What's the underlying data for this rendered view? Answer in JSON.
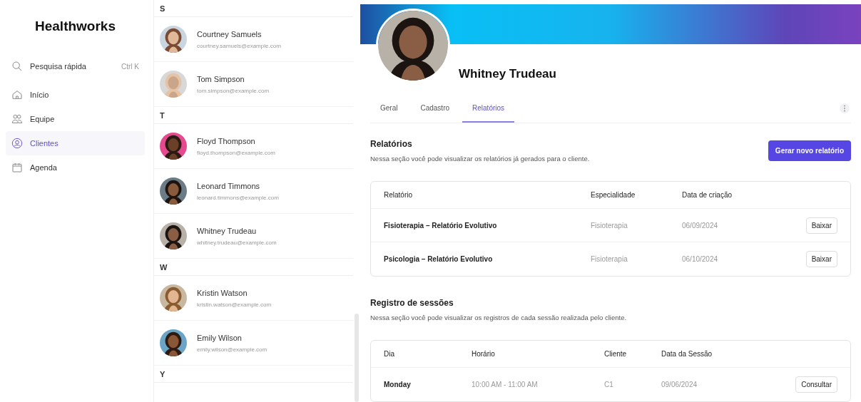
{
  "sidebar": {
    "title": "Healthworks",
    "search": {
      "label": "Pesquisa rápida",
      "shortcut": "Ctrl K"
    },
    "items": [
      {
        "label": "Início",
        "selected": false
      },
      {
        "label": "Equipe",
        "selected": false
      },
      {
        "label": "Clientes",
        "selected": true
      },
      {
        "label": "Agenda",
        "selected": false
      }
    ]
  },
  "contacts": [
    {
      "letter": "S",
      "people": [
        {
          "name": "Courtney Samuels",
          "email": "courtney.samuels@example.com"
        },
        {
          "name": "Tom Simpson",
          "email": "tom.simpson@example.com"
        }
      ]
    },
    {
      "letter": "T",
      "people": [
        {
          "name": "Floyd Thompson",
          "email": "floyd.thompson@example.com"
        },
        {
          "name": "Leonard Timmons",
          "email": "leonard.timmons@example.com"
        },
        {
          "name": "Whitney Trudeau",
          "email": "whitney.trudeau@example.com"
        }
      ]
    },
    {
      "letter": "W",
      "people": [
        {
          "name": "Kristin Watson",
          "email": "kristin.watson@example.com"
        },
        {
          "name": "Emily Wilson",
          "email": "emily.wilson@example.com"
        }
      ]
    },
    {
      "letter": "Y"
    }
  ],
  "profile": {
    "name": "Whitney Trudeau",
    "tabs": [
      {
        "label": "Geral",
        "selected": false
      },
      {
        "label": "Cadastro",
        "selected": false
      },
      {
        "label": "Relatórios",
        "selected": true
      }
    ]
  },
  "reports": {
    "title": "Relatórios",
    "description": "Nessa seção você pode visualizar os relatórios já gerados para o cliente.",
    "button": "Gerar novo relatório",
    "columns": [
      "Relatório",
      "Especialidade",
      "Data de criação"
    ],
    "rows": [
      {
        "report": "Fisioterapia – Relatório Evolutivo",
        "specialty": "Fisioterapia",
        "date": "06/09/2024",
        "action": "Baixar"
      },
      {
        "report": "Psicologia – Relatório Evolutivo",
        "specialty": "Fisioterapia",
        "date": "06/10/2024",
        "action": "Baixar"
      }
    ]
  },
  "sessions": {
    "title": "Registro de sessões",
    "description": "Nessa seção você pode visualizar os registros de cada sessão realizada pelo cliente.",
    "columns": [
      "Dia",
      "Horário",
      "Cliente",
      "Data da Sessão"
    ],
    "rows": [
      {
        "day": "Monday",
        "time": "10:00 AM - 11:00 AM",
        "client": "C1",
        "date": "09/06/2024",
        "action": "Consultar"
      }
    ]
  }
}
